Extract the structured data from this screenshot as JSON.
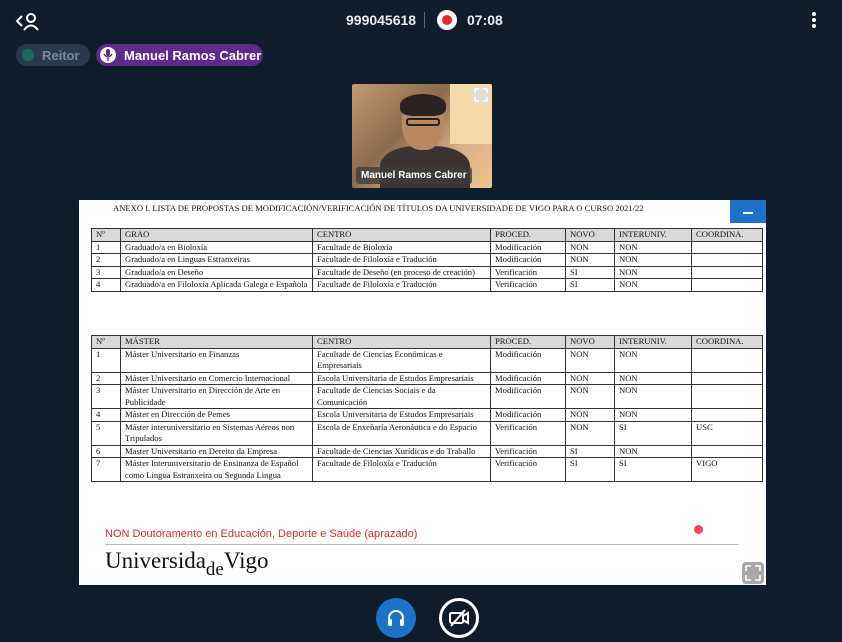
{
  "header": {
    "meeting_id": "999045618",
    "recording_time": "07:08"
  },
  "participants": {
    "reitor_label": "Reitor",
    "speaker_label": "Manuel Ramos Cabrer"
  },
  "video": {
    "name_tag": "Manuel Ramos Cabrer"
  },
  "document": {
    "title": "ANEXO I. LISTA DE PROPOSTAS DE MODIFICACIÓN/VERIFICACIÓN DE TÍTULOS DA UNIVERSIDADE DE VIGO PARA O CURSO 2021/22",
    "grao_headers": [
      "Nº",
      "GRAO",
      "CENTRO",
      "PROCED.",
      "NOVO",
      "INTERUNIV.",
      "COORDINA."
    ],
    "grao_rows": [
      [
        "1",
        "Graduado/a en Bioloxía",
        "Facultade de Bioloxía",
        "Modificación",
        "NON",
        "NON",
        ""
      ],
      [
        "2",
        "Graduado/a en Linguas Estranxeiras",
        "Facultade de Filoloxía e Tradución",
        "Modificación",
        "NON",
        "NON",
        ""
      ],
      [
        "3",
        "Graduado/a en Deseño",
        "Facultade de Deseño (en proceso de creación)",
        "Verificación",
        "SI",
        "NON",
        ""
      ],
      [
        "4",
        "Graduado/a en Filoloxía Aplicada Galega e Española",
        "Facultade de Filoloxía e Tradución",
        "Verificación",
        "SI",
        "NON",
        ""
      ]
    ],
    "master_headers": [
      "Nº",
      "MÁSTER",
      "CENTRO",
      "PROCED.",
      "NOVO",
      "INTERUNIV.",
      "COORDINA."
    ],
    "master_rows": [
      [
        "1",
        "Máster Universitario en Finanzas",
        "Facultade de Ciencias Económicas e Empresariais",
        "Modificación",
        "NON",
        "NON",
        ""
      ],
      [
        "2",
        "Máster Universitario en Comercio Internacional",
        "Escola Universitaria de Estudos Empresariais",
        "Modificación",
        "NON",
        "NON",
        ""
      ],
      [
        "3",
        "Máster Universitario en Dirección de Arte en Publicidade",
        "Facultade de Ciencias Sociais e da Comunicación",
        "Modificación",
        "NON",
        "NON",
        ""
      ],
      [
        "4",
        "Máster en Dirección de Pemes",
        "Escola Universitaria de Estudos Empresariais",
        "Modificación",
        "NON",
        "NON",
        ""
      ],
      [
        "5",
        "Máster interuniversitario en Sistemas Aéreos non Tripulados",
        "Escola de Enxeñaría Aeronáutica e do Espacio",
        "Verificación",
        "NON",
        "SI",
        "USC"
      ],
      [
        "6",
        "Master Universitario en Dereito da Empresa",
        "Facultade de Ciencias Xurídicas e do Traballo",
        "Verificación",
        "SI",
        "NON",
        ""
      ],
      [
        "7",
        "Máster Interuniversitario de Ensinanza de Español como Lingua Estranxeira ou Segunda Lingua",
        "Facultade de Filoloxía e Tradución",
        "Verificación",
        "SI",
        "SI",
        "VIGO"
      ]
    ],
    "non_doutoramento": "NON Doutoramento en Educación, Deporte e Saúde (aprazado)",
    "logo": {
      "part1": "Universida",
      "part2": "de",
      "part3": "Vigo"
    }
  },
  "colors": {
    "background": "#0f1c2c",
    "accent": "#1d73c9",
    "speaker_pill": "#5e2a8c",
    "recording": "#e3262f"
  }
}
